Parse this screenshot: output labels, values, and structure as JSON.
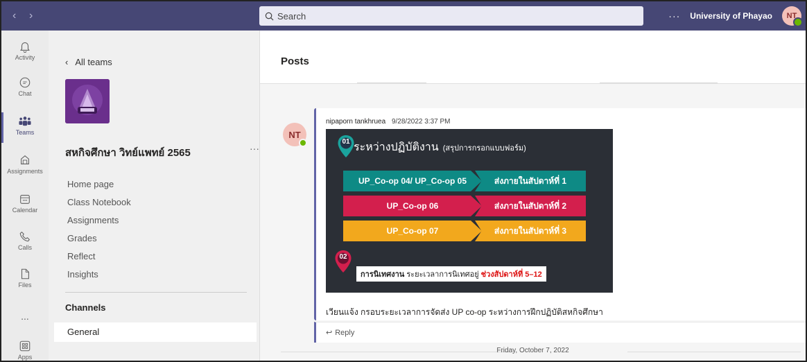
{
  "topbar": {
    "search_placeholder": "Search",
    "more": "···",
    "org_name": "University of Phayao",
    "avatar_initials": "NT"
  },
  "rail": {
    "items": [
      {
        "label": "Activity",
        "icon": "bell-icon"
      },
      {
        "label": "Chat",
        "icon": "chat-icon"
      },
      {
        "label": "Teams",
        "icon": "teams-icon"
      },
      {
        "label": "Assignments",
        "icon": "assignments-icon"
      },
      {
        "label": "Calendar",
        "icon": "calendar-icon"
      },
      {
        "label": "Calls",
        "icon": "phone-icon"
      },
      {
        "label": "Files",
        "icon": "file-icon"
      },
      {
        "label": "...",
        "icon": "more-icon"
      },
      {
        "label": "Apps",
        "icon": "apps-icon"
      }
    ]
  },
  "team_panel": {
    "back_label": "All teams",
    "team_name": "สหกิจศึกษา วิทย์แพทย์ 2565",
    "more": "···",
    "links": [
      "Home page",
      "Class Notebook",
      "Assignments",
      "Grades",
      "Reflect",
      "Insights"
    ],
    "channels_heading": "Channels",
    "channels": [
      "General"
    ]
  },
  "main": {
    "title": "Posts",
    "post": {
      "author_initials": "NT",
      "author": "nipaporn tankhruea",
      "timestamp": "9/28/2022 3:37 PM",
      "body": "เวียนแจ้ง กรอบระยะเวลาการจัดส่ง UP co-op ระหว่างการฝึกปฏิบัติสหกิจศึกษา",
      "reply_label": "Reply"
    },
    "date_separator": "Friday, October 7, 2022"
  },
  "infographic": {
    "pin1": "01",
    "heading": "ระหว่างปฏิบัติงาน",
    "heading_note": "(สรุปการกรอกแบบฟอร์ม)",
    "rows": [
      {
        "form": "UP_Co-op 04/ UP_Co-op 05",
        "deadline": "ส่งภายในสัปดาห์ที่ 1",
        "color": "#0e8a85"
      },
      {
        "form": "UP_Co-op 06",
        "deadline": "ส่งภายในสัปดาห์ที่ 2",
        "color": "#d31f4d"
      },
      {
        "form": "UP_Co-op 07",
        "deadline": "ส่งภายในสัปดาห์ที่ 3",
        "color": "#f2a81d"
      }
    ],
    "pin2": "02",
    "supervise_label": "การนิเทศงาน",
    "supervise_text": "ระยะเวลาการนิเทศอยู่",
    "supervise_weeks": "ช่วงสัปดาห์ที่ 5–12"
  },
  "colors": {
    "brand": "#464775",
    "accent": "#6264a7"
  }
}
